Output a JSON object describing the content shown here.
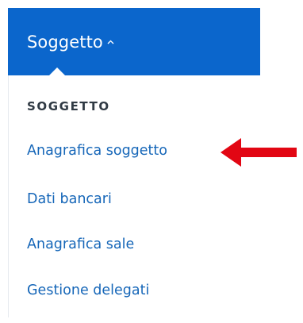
{
  "nav": {
    "toggle_label": "Soggetto",
    "expand_icon": "chevron-up-icon",
    "background_color": "#0b66cc"
  },
  "dropdown": {
    "heading": "SOGGETTO",
    "items": [
      {
        "label": "Anagrafica soggetto"
      },
      {
        "label": "Dati bancari"
      },
      {
        "label": "Anagrafica sale"
      },
      {
        "label": "Gestione delegati"
      }
    ],
    "link_color": "#1566b8"
  },
  "annotation": {
    "icon": "red-arrow-left-icon",
    "color": "#e20613"
  }
}
